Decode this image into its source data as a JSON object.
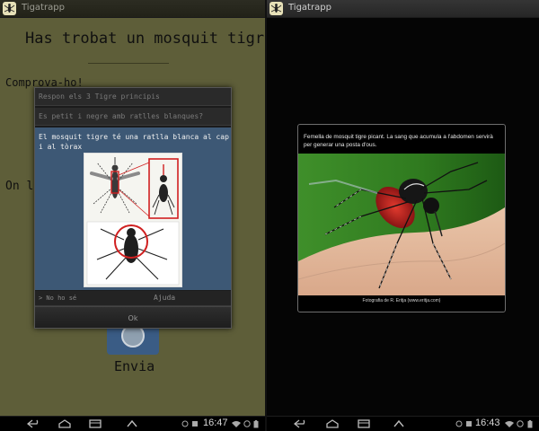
{
  "left_screen": {
    "app_title": "Tigatrapp",
    "question": "Has trobat un mosquit tigre?",
    "verify_label": "Comprova-ho!",
    "partial_text": "On l",
    "send_label": "Envia",
    "dialog": {
      "option_1": "Respon els 3 Tigre principis",
      "option_2": "Es petit i negre amb ratlles blanques?",
      "panel_text": "El mosquit tigre té una ratlla blanca al cap i al tòrax",
      "no_ho_se": "> No ho sé",
      "help_label": "Ajuda",
      "ok_label": "Ok"
    },
    "status": {
      "time": "16:47"
    }
  },
  "right_screen": {
    "app_title": "Tigatrapp",
    "caption": "Femella de mosquit tigre picant. La sang que acumula a l'abdomen servirà per generar una posta d'ous.",
    "credit": "Fotografia de R. Eritja (www.eritja.com)",
    "status": {
      "time": "16:43"
    }
  },
  "colors": {
    "left_bg": "#5e5e39",
    "dialog_panel": "#3d5875",
    "highlight_red": "#d02020",
    "right_bg": "#050505"
  },
  "icons": [
    "app-mosquito-icon",
    "back-icon",
    "home-icon",
    "recent-apps-icon",
    "up-chevron-icon",
    "wifi-icon",
    "battery-icon",
    "notification-icon"
  ]
}
